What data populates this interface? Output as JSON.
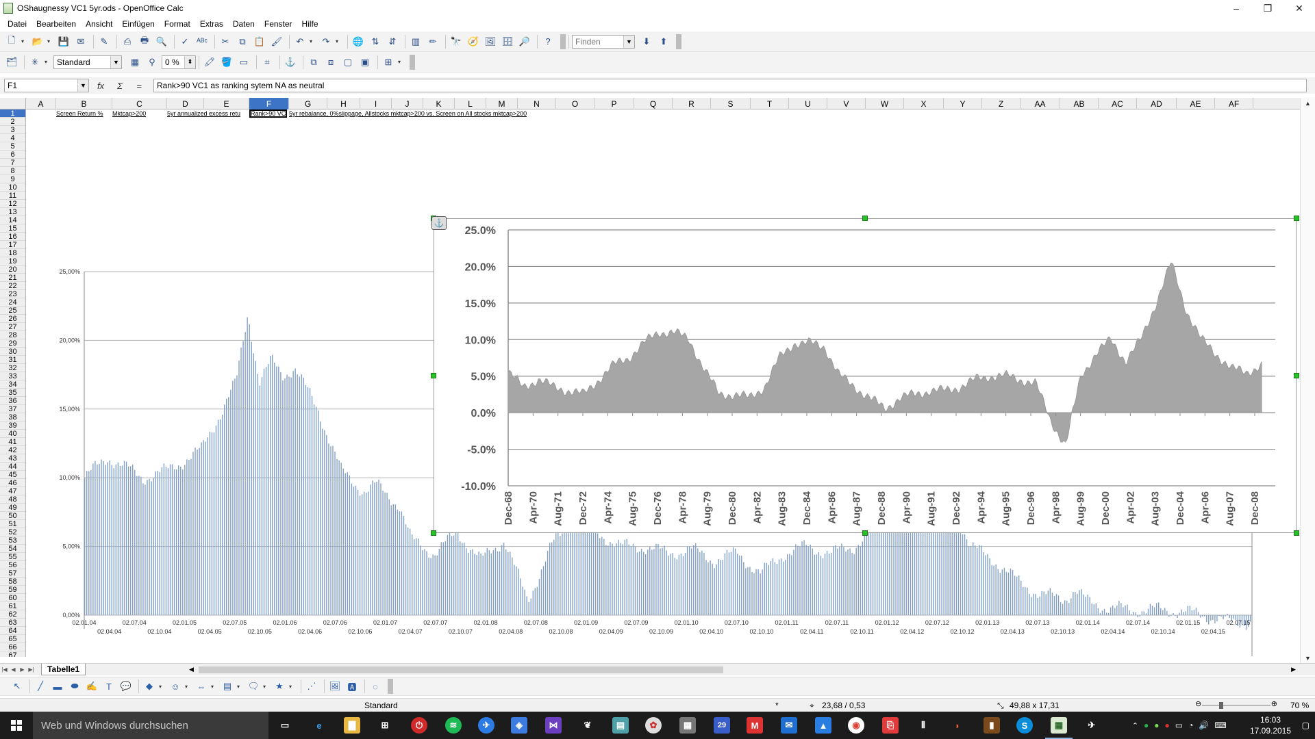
{
  "window": {
    "title": "OShaugnessy VC1 5yr.ods - OpenOffice Calc",
    "minimize": "–",
    "maximize": "❐",
    "close": "✕"
  },
  "menu": [
    "Datei",
    "Bearbeiten",
    "Ansicht",
    "Einfügen",
    "Format",
    "Extras",
    "Daten",
    "Fenster",
    "Hilfe"
  ],
  "toolbar1": {
    "find_placeholder": "Finden"
  },
  "toolbar2": {
    "style_value": "Standard",
    "percent_value": "0 %"
  },
  "formula": {
    "cell_ref": "F1",
    "fx_label": "fx",
    "sum_label": "Σ",
    "eq_label": "=",
    "content": "Rank>90 VC1 as ranking sytem NA as neutral"
  },
  "sheet": {
    "columns": [
      "A",
      "B",
      "C",
      "D",
      "E",
      "F",
      "G",
      "H",
      "I",
      "J",
      "K",
      "L",
      "M",
      "N",
      "O",
      "P",
      "Q",
      "R",
      "S",
      "T",
      "U",
      "V",
      "W",
      "X",
      "Y",
      "Z",
      "AA",
      "AB",
      "AC",
      "AD",
      "AE",
      "AF"
    ],
    "selected_column": "F",
    "rows": [
      "1",
      "2",
      "3",
      "4",
      "5",
      "6",
      "7",
      "8",
      "9",
      "10",
      "11",
      "12",
      "13",
      "14",
      "15",
      "16",
      "17",
      "18",
      "19",
      "20",
      "21",
      "22",
      "23",
      "24",
      "25",
      "26",
      "27",
      "28",
      "29",
      "30",
      "31",
      "32",
      "33",
      "34",
      "35",
      "36",
      "37",
      "38",
      "39",
      "40",
      "41",
      "42",
      "43",
      "44",
      "45",
      "46",
      "47",
      "48",
      "49",
      "50",
      "51",
      "52",
      "53",
      "54",
      "55",
      "56",
      "57",
      "58",
      "59",
      "60",
      "61",
      "62",
      "63",
      "64",
      "65",
      "66",
      "67"
    ],
    "selected_row": "1",
    "row1_cells": [
      {
        "col": "B",
        "text": "Screen Return %"
      },
      {
        "col": "C",
        "text": "Mktcap>200"
      },
      {
        "col": "D",
        "text": "5yr annualized excess retu"
      },
      {
        "col": "F",
        "text": "Rank>90 VC"
      },
      {
        "col": "G",
        "text": "5yr rebalance, 0%slippage, Allstocks mktcap>200 vs. Screen on All stocks mktcap>200"
      }
    ],
    "tab": "Tabelle1"
  },
  "chart_data": [
    {
      "type": "bar",
      "title": "",
      "xlabel": "",
      "ylabel": "",
      "ylim": [
        0,
        0.25
      ],
      "y_ticks": [
        "0,00%",
        "5,00%",
        "10,00%",
        "15,00%",
        "20,00%",
        "25,00%"
      ],
      "x_ticks_top": [
        "02.01.04",
        "02.07.04",
        "02.01.05",
        "02.07.05",
        "02.01.06",
        "02.07.06",
        "02.01.07",
        "02.07.07",
        "02.01.08",
        "02.07.08",
        "02.01.09",
        "02.07.09",
        "02.01.10",
        "02.07.10",
        "02.01.11",
        "02.07.11",
        "02.01.12",
        "02.07.12",
        "02.01.13",
        "02.07.13",
        "02.01.14",
        "02.07.14",
        "02.01.15",
        "02.07.15"
      ],
      "x_ticks_bottom": [
        "02.04.04",
        "02.10.04",
        "02.04.05",
        "02.10.05",
        "02.04.06",
        "02.10.06",
        "02.04.07",
        "02.10.07",
        "02.04.08",
        "02.10.08",
        "02.04.09",
        "02.10.09",
        "02.04.10",
        "02.10.10",
        "02.04.11",
        "02.10.11",
        "02.04.12",
        "02.10.12",
        "02.04.13",
        "02.10.13",
        "02.04.14",
        "02.10.14",
        "02.04.15"
      ],
      "series": [
        {
          "color": "#7f9ec6",
          "profile_x": [
            0,
            0.02,
            0.05,
            0.07,
            0.1,
            0.13,
            0.14,
            0.15,
            0.16,
            0.17,
            0.18,
            0.2,
            0.22,
            0.24,
            0.25,
            0.27,
            0.28,
            0.3,
            0.32,
            0.34,
            0.36,
            0.38,
            0.4,
            0.42,
            0.44,
            0.45,
            0.46,
            0.48,
            0.5,
            0.52,
            0.54,
            0.56,
            0.58,
            0.6,
            0.62,
            0.64,
            0.66,
            0.68,
            0.7,
            0.72,
            0.74,
            0.76,
            0.78,
            0.8,
            0.82,
            0.84,
            0.85,
            0.86,
            0.88,
            0.9,
            0.92,
            0.94,
            0.96,
            0.98,
            1.0
          ],
          "profile_y": [
            0.1,
            0.115,
            0.1,
            0.105,
            0.12,
            0.17,
            0.22,
            0.17,
            0.185,
            0.175,
            0.18,
            0.15,
            0.105,
            0.09,
            0.095,
            0.08,
            0.055,
            0.045,
            0.06,
            0.04,
            0.055,
            0.01,
            0.05,
            0.07,
            0.06,
            0.055,
            0.05,
            0.05,
            0.045,
            0.048,
            0.04,
            0.045,
            0.03,
            0.045,
            0.05,
            0.045,
            0.05,
            0.065,
            0.075,
            0.085,
            0.09,
            0.05,
            0.04,
            0.025,
            0.015,
            0.012,
            0.018,
            0.01,
            0.005,
            0.004,
            0.004,
            0.003,
            0.0,
            -0.005,
            -0.005
          ]
        }
      ]
    },
    {
      "type": "area",
      "title": "",
      "xlabel": "",
      "ylabel": "",
      "ylim": [
        -0.1,
        0.25
      ],
      "y_ticks": [
        "25.0%",
        "20.0%",
        "15.0%",
        "10.0%",
        "5.0%",
        "0.0%",
        "-5.0%",
        "-10.0%"
      ],
      "x_ticks": [
        "Dec-68",
        "Apr-70",
        "Aug-71",
        "Dec-72",
        "Apr-74",
        "Aug-75",
        "Dec-76",
        "Apr-78",
        "Aug-79",
        "Dec-80",
        "Apr-82",
        "Aug-83",
        "Dec-84",
        "Apr-86",
        "Aug-87",
        "Dec-88",
        "Apr-90",
        "Aug-91",
        "Dec-92",
        "Apr-94",
        "Aug-95",
        "Dec-96",
        "Apr-98",
        "Aug-99",
        "Dec-00",
        "Apr-02",
        "Aug-03",
        "Dec-04",
        "Apr-06",
        "Aug-07",
        "Dec-08"
      ],
      "series": [
        {
          "color": "#a6a6a6",
          "profile_x": [
            0,
            0.02,
            0.04,
            0.06,
            0.08,
            0.1,
            0.12,
            0.14,
            0.16,
            0.18,
            0.2,
            0.22,
            0.24,
            0.26,
            0.28,
            0.3,
            0.32,
            0.34,
            0.36,
            0.38,
            0.4,
            0.42,
            0.44,
            0.46,
            0.48,
            0.5,
            0.52,
            0.54,
            0.56,
            0.58,
            0.6,
            0.62,
            0.64,
            0.66,
            0.68,
            0.7,
            0.72,
            0.74,
            0.76,
            0.78,
            0.8,
            0.82,
            0.84,
            0.86,
            0.88,
            0.9,
            0.92,
            0.94,
            0.96,
            0.98,
            1.0
          ],
          "profile_y": [
            0.055,
            0.035,
            0.045,
            0.035,
            0.03,
            0.025,
            0.045,
            0.065,
            0.075,
            0.095,
            0.11,
            0.11,
            0.1,
            0.06,
            0.025,
            0.025,
            0.02,
            0.035,
            0.075,
            0.095,
            0.095,
            0.09,
            0.05,
            0.035,
            0.02,
            0.005,
            0.02,
            0.025,
            0.03,
            0.03,
            0.035,
            0.045,
            0.05,
            0.05,
            0.045,
            0.04,
            -0.01,
            -0.045,
            0.05,
            0.08,
            0.1,
            0.07,
            0.1,
            0.15,
            0.205,
            0.14,
            0.1,
            0.08,
            0.06,
            0.055,
            0.065
          ]
        }
      ]
    }
  ],
  "drawbar": {},
  "status": {
    "style": "Standard",
    "mark": "*",
    "position": "23,68 / 0,53",
    "size": "49,88 x 17,31",
    "zoom": "70 %"
  },
  "taskbar": {
    "search_placeholder": "Web und Windows durchsuchen",
    "time": "16:03",
    "date": "17.09.2015",
    "calendar_day": "29"
  }
}
